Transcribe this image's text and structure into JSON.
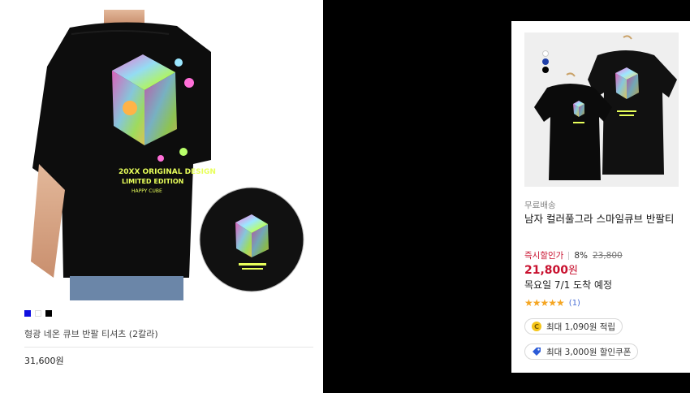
{
  "left_card": {
    "title": "형광 네온 큐브 반팔 티셔츠 (2칼라)",
    "price": "31,600원",
    "colors": [
      "#1010e0",
      "#ffffff",
      "#000000"
    ],
    "hero_print": {
      "line1": "20XX ORIGINAL DESIGN",
      "line2": "LIMITED EDITION",
      "line3": "HAPPY CUBE"
    }
  },
  "right_card": {
    "badge": "무료배송",
    "title": "남자 컬러풀그라 스마일큐브 반팔티",
    "discount_label": "즉시할인가",
    "discount_pct": "8%",
    "original_price": "23,800",
    "sale_price": "21,800",
    "sale_unit": "원",
    "arrival": "목요일 7/1 도착 예정",
    "stars": "★★★★★",
    "review_count": "(1)",
    "rating": 5,
    "reward_label": "최대 1,090원 적립",
    "coupon_label": "최대 3,000원 할인쿠폰",
    "colors": [
      "#ffffff",
      "#1f3fa8",
      "#000000"
    ]
  }
}
